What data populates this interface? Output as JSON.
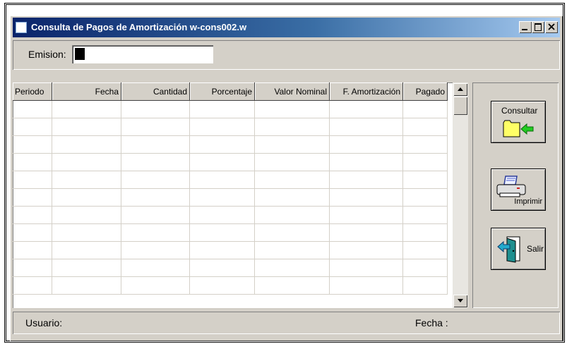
{
  "window": {
    "title": "Consulta de Pagos de Amortización w-cons002.w"
  },
  "emission": {
    "label": "Emision:",
    "value": ""
  },
  "grid": {
    "columns": [
      "Periodo",
      "Fecha",
      "Cantidad",
      "Porcentaje",
      "Valor Nominal",
      "F. Amortización",
      "Pagado"
    ],
    "rows": []
  },
  "buttons": {
    "consultar": "Consultar",
    "imprimir": "Imprimir",
    "salir": "Salir"
  },
  "status": {
    "user_label": "Usuario:",
    "date_label": "Fecha :"
  },
  "colors": {
    "titlebar_start": "#0a246a",
    "titlebar_end": "#a6caf0",
    "face": "#d4d0c8",
    "arrow_green": "#22cc22",
    "folder_yellow": "#ffff66",
    "door_teal": "#1f8f8f"
  },
  "icons": {
    "title": "window-app-icon",
    "consultar": "folder-arrow-icon",
    "imprimir": "printer-icon",
    "salir": "exit-door-icon"
  }
}
